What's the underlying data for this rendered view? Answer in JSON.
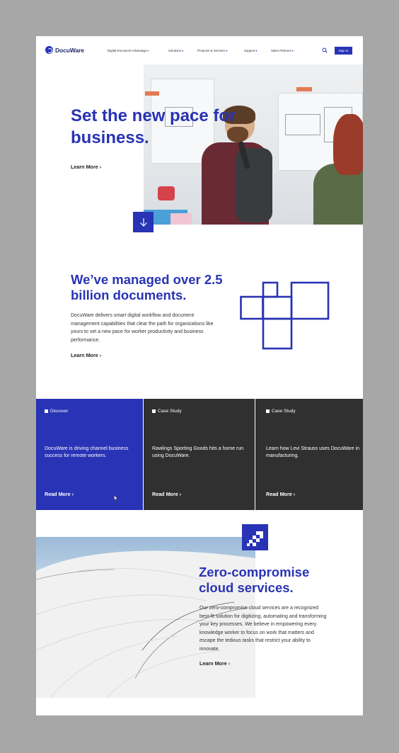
{
  "header": {
    "logo_text": "DocuWare",
    "nav": [
      {
        "label": "Digital Document Advantage"
      },
      {
        "label": "Solutions"
      },
      {
        "label": "Products & Services"
      },
      {
        "label": "Support"
      },
      {
        "label": "Sales Partners"
      }
    ],
    "signin_label": "Sign In"
  },
  "hero": {
    "title": "Set the new pace for business.",
    "learn_more": "Learn More"
  },
  "managed": {
    "title": "We’ve managed over 2.5 billion documents.",
    "body": "DocuWare delivers smart digital workflow and document management capabilities that clear the path for organizations like yours to set a new pace for worker productivity and business performance.",
    "learn_more": "Learn More"
  },
  "cards": [
    {
      "tag": "Discover",
      "text": "DocuWare is driving channel business success for remote workers.",
      "link": "Read More"
    },
    {
      "tag": "Case Study",
      "text": "Rawlings Sporting Goods hits a home run using DocuWare.",
      "link": "Read More"
    },
    {
      "tag": "Case Study",
      "text": "Learn how Levi Strauss uses DocuWare in manufacturing.",
      "link": "Read More"
    }
  ],
  "cloud": {
    "title": "Zero-compromise cloud services.",
    "body": "Our zero-compromise cloud services are a recognized best-fit solution for digitizing, automating and transforming your key processes. We believe in empowering every knowledge worker to focus on work that matters and escape the tedious tasks that restrict your ability to innovate.",
    "learn_more": "Learn More"
  },
  "colors": {
    "brand_blue": "#2833b5",
    "card_dark": "#303030",
    "page_bg": "#a7a7a7"
  },
  "icons": [
    "docuware-logo-icon",
    "chevron-down-icon",
    "search-icon",
    "arrow-down-icon",
    "chevron-right-icon",
    "squares-graphic-icon",
    "stairs-icon",
    "cursor-icon"
  ]
}
